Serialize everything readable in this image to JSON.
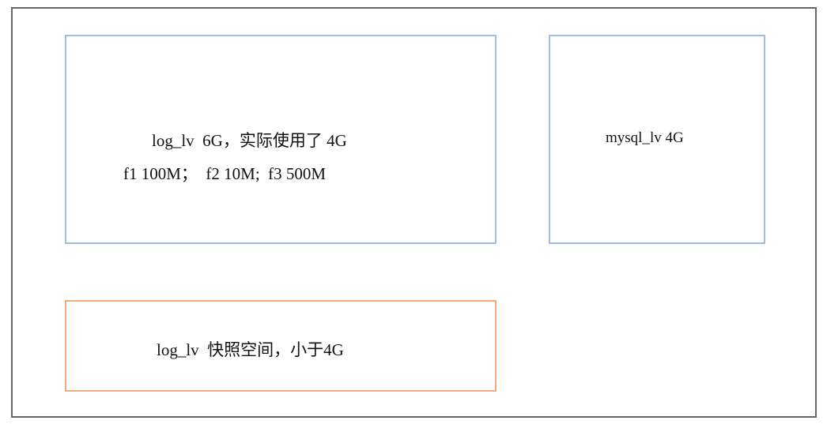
{
  "boxes": {
    "log_lv": {
      "line1": "log_lv  6G，实际使用了 4G",
      "line2": "f1 100M；  f2 10M;  f3 500M"
    },
    "mysql_lv": {
      "label": "mysql_lv 4G"
    },
    "snapshot": {
      "label": "log_lv  快照空间，小于4G"
    }
  },
  "colors": {
    "volume_border": "#9bbde8",
    "snapshot_border": "#f2ab7c",
    "frame_border": "#666666"
  }
}
